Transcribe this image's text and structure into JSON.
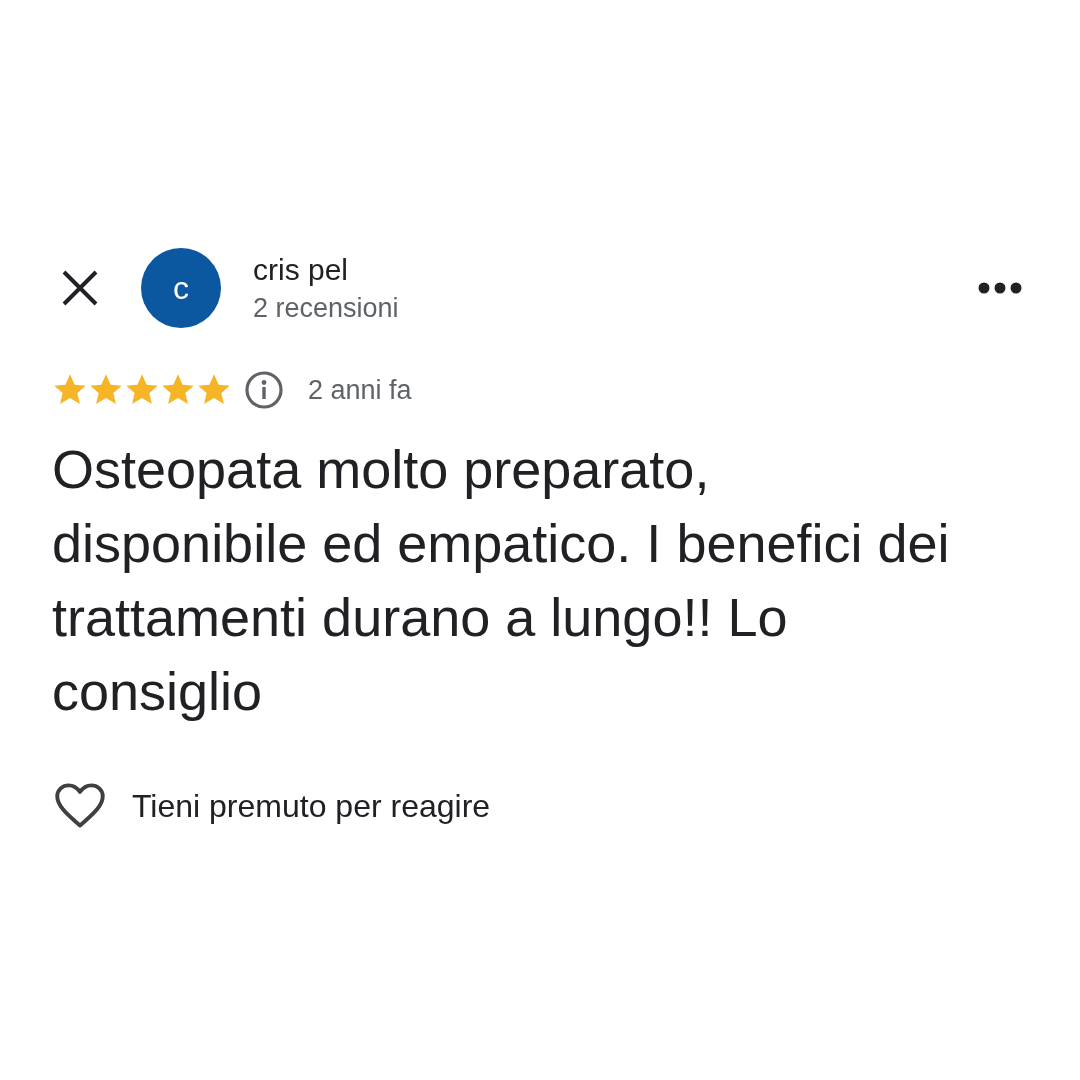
{
  "reviewer": {
    "initial": "c",
    "name": "cris pel",
    "reviews": "2 recensioni"
  },
  "rating": {
    "stars": 5,
    "time": "2 anni fa"
  },
  "review_text": "Osteopata molto preparato, disponibile ed empatico. I benefici dei trattamenti durano a lungo!! Lo consiglio",
  "reaction": {
    "label": "Tieni premuto per reagire",
    "liked": false
  }
}
